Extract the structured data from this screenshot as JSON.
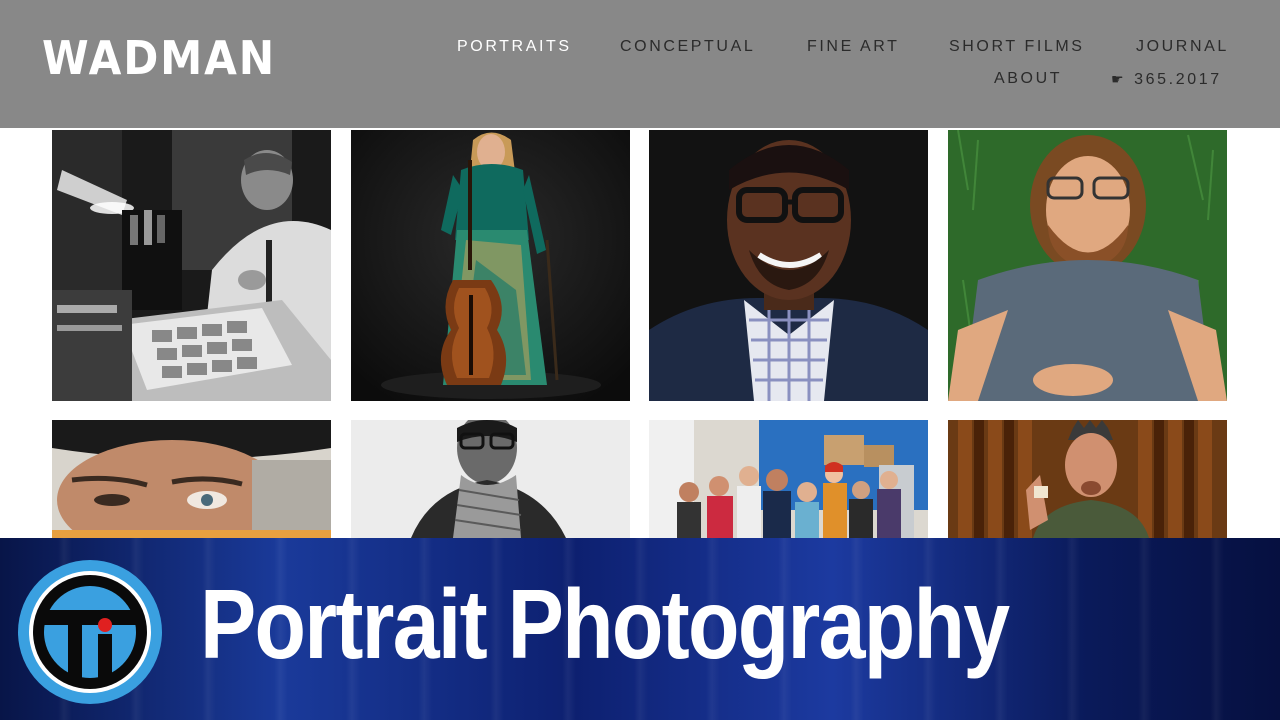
{
  "site": {
    "logo": "WADMAN",
    "nav": {
      "portraits": "PORTRAITS",
      "conceptual": "CONCEPTUAL",
      "fine_art": "FINE ART",
      "short_films": "SHORT FILMS",
      "journal": "JOURNAL",
      "about": "ABOUT",
      "year_project": "365.2017"
    },
    "active_nav": "portraits",
    "colors": {
      "header_bg": "#888888",
      "active_link": "#ffffff",
      "link": "#2b2b2b"
    }
  },
  "gallery": {
    "photos": [
      {
        "subject": "man-at-desk-with-newspaper",
        "style": "black-and-white"
      },
      {
        "subject": "woman-with-cello"
      },
      {
        "subject": "smiling-man-with-glasses"
      },
      {
        "subject": "man-lying-on-grass"
      },
      {
        "subject": "man-in-hat-closeup"
      },
      {
        "subject": "man-with-scarf",
        "style": "black-and-white"
      },
      {
        "subject": "group-in-office"
      },
      {
        "subject": "man-with-curtain-background"
      }
    ]
  },
  "lower_third": {
    "logo_icon": "twit-logo",
    "title": "Portrait Photography",
    "colors": {
      "banner": "#12307f",
      "logo_blue": "#3aa0e0",
      "logo_red": "#e02020"
    }
  }
}
